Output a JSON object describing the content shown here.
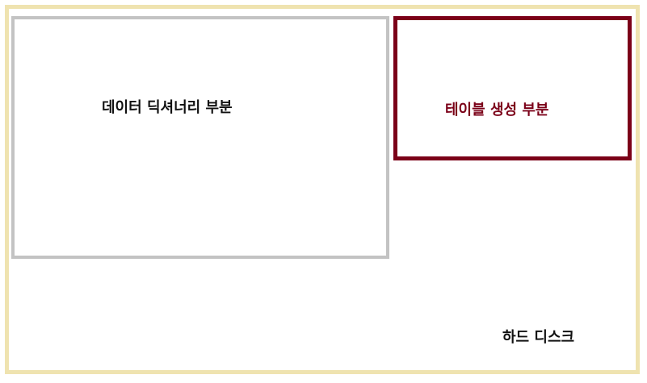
{
  "diagram": {
    "labels": {
      "data_dictionary": "데이터 딕셔너리 부분",
      "table_creation": "테이블 생성 부분",
      "hard_disk": "하드 디스크"
    },
    "colors": {
      "outer_border": "#efe3b0",
      "data_dictionary_border": "#c3c3c3",
      "table_creation_border": "#7b0018",
      "table_creation_text": "#7b0018",
      "default_text": "#111111",
      "background": "#ffffff"
    }
  }
}
